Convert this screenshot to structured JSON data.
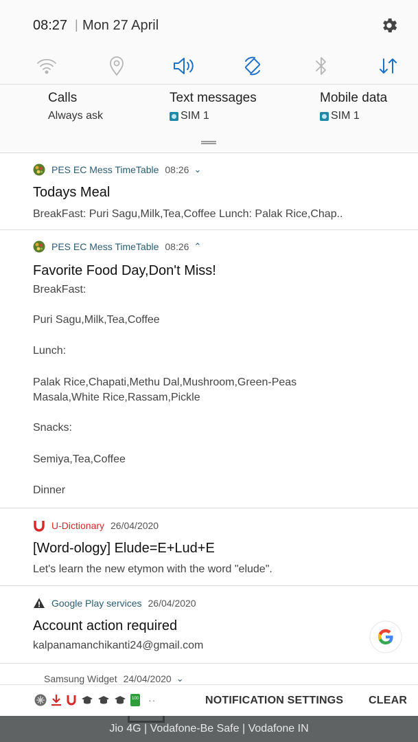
{
  "status": {
    "time": "08:27",
    "separator": "|",
    "date": "Mon 27 April"
  },
  "toggles": [
    {
      "icon": "wifi-icon",
      "active": false
    },
    {
      "icon": "location-icon",
      "active": false
    },
    {
      "icon": "sound-icon",
      "active": true
    },
    {
      "icon": "auto-rotate-icon",
      "active": true
    },
    {
      "icon": "bluetooth-icon",
      "active": false
    },
    {
      "icon": "mobile-data-icon",
      "active": true
    }
  ],
  "sim_panel": {
    "calls": {
      "title": "Calls",
      "value": "Always ask"
    },
    "text_messages": {
      "title": "Text messages",
      "value": "SIM 1"
    },
    "mobile_data": {
      "title": "Mobile data",
      "value": "SIM 1"
    }
  },
  "notifications": [
    {
      "app": "PES EC Mess TimeTable",
      "time": "08:26",
      "expand": "⌄",
      "title": "Todays Meal",
      "body": "BreakFast:  Puri Sagu,Milk,Tea,Coffee  Lunch:  Palak Rice,Chap.."
    },
    {
      "app": "PES EC Mess TimeTable",
      "time": "08:26",
      "expand": "⌃",
      "title": "Favorite Food Day,Don't Miss!",
      "lines": [
        "BreakFast:",
        "Puri Sagu,Milk,Tea,Coffee",
        "Lunch:",
        "Palak Rice,Chapati,Methu Dal,Mushroom,Green-Peas",
        "Masala,White Rice,Rassam,Pickle",
        "Snacks:",
        "Semiya,Tea,Coffee",
        "Dinner"
      ]
    },
    {
      "app": "U-Dictionary",
      "time": "26/04/2020",
      "title": "[Word-ology] Elude=E+Lud+E",
      "body": "Let's learn the new etymon with the word \"elude\"."
    },
    {
      "app": "Google Play services",
      "time": "26/04/2020",
      "title": "Account action required",
      "body": "kalpanamanchikanti24@gmail.com"
    },
    {
      "app": "Samsung Widget",
      "time": "24/04/2020",
      "expand": "⌄"
    }
  ],
  "bottom": {
    "more": "··",
    "notification_settings": "NOTIFICATION SETTINGS",
    "clear": "CLEAR",
    "battery_label": "100"
  },
  "carrier": "Jio 4G | Vodafone-Be Safe | Vodafone IN",
  "colors": {
    "accent": "#1e6fc6",
    "inactive": "#b5b5b5",
    "udictionary_red": "#d62828"
  }
}
